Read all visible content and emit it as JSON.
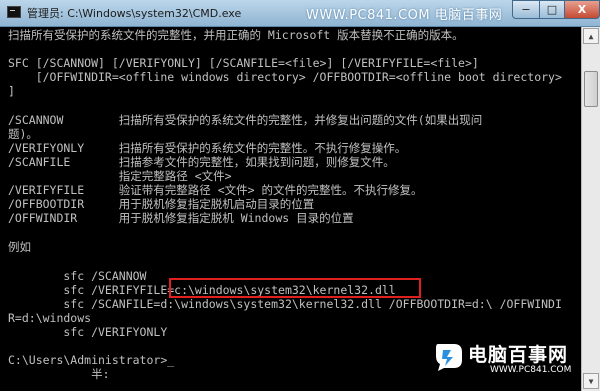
{
  "window": {
    "title": "管理员: C:\\Windows\\system32\\CMD.exe",
    "watermark": "WWW.PC841.COM 电脑百事网",
    "buttons": {
      "minimize": "−",
      "maximize": "□",
      "close": "X"
    }
  },
  "console": {
    "lines": [
      "扫描所有受保护的系统文件的完整性，并用正确的 Microsoft 版本替换不正确的版本。",
      "",
      "SFC [/SCANNOW] [/VERIFYONLY] [/SCANFILE=<file>] [/VERIFYFILE=<file>]",
      "    [/OFFWINDIR=<offline windows directory> /OFFBOOTDIR=<offline boot directory>",
      "]",
      "",
      "/SCANNOW        扫描所有受保护的系统文件的完整性，并修复出问题的文件(如果出现问",
      "题)。",
      "/VERIFYONLY     扫描所有受保护的系统文件的完整性。不执行修复操作。",
      "/SCANFILE       扫描参考文件的完整性，如果找到问题，则修复文件。",
      "                指定完整路径 <文件>",
      "/VERIFYFILE     验证带有完整路径 <文件> 的文件的完整性。不执行修复。",
      "/OFFBOOTDIR     用于脱机修复指定脱机启动目录的位置",
      "/OFFWINDIR      用于脱机修复指定脱机 Windows 目录的位置",
      "",
      "例如",
      "",
      "        sfc /SCANNOW",
      "        sfc /VERIFYFILE=c:\\windows\\system32\\kernel32.dll",
      "        sfc /SCANFILE=d:\\windows\\system32\\kernel32.dll /OFFBOOTDIR=d:\\ /OFFWINDI",
      "R=d:\\windows",
      "        sfc /VERIFYONLY",
      "",
      "C:\\Users\\Administrator>_",
      "            半:"
    ]
  },
  "logo": {
    "name": "电脑百事网",
    "url": "WWW.PC841.COM"
  },
  "colors": {
    "console_bg": "#000000",
    "console_text": "#c0c0c0",
    "highlight": "#e02020",
    "titlebar": "#9fc0dc"
  }
}
